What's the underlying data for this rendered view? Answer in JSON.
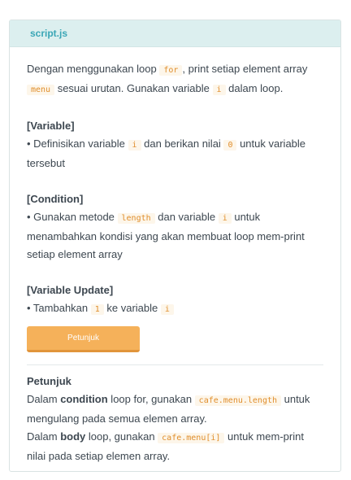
{
  "filename": "script.js",
  "intro": {
    "t1": "Dengan menggunakan loop ",
    "c1": "for",
    "t2": ", print setiap element array ",
    "c2": "menu",
    "t3": " sesuai urutan. Gunakan variable ",
    "c3": "i",
    "t4": " dalam loop."
  },
  "variable": {
    "title": "[Variable]",
    "t1": "• Definisikan variable ",
    "c1": "i",
    "t2": " dan berikan nilai ",
    "c2": "0",
    "t3": " untuk variable tersebut"
  },
  "condition": {
    "title": "[Condition]",
    "t1": "• Gunakan metode ",
    "c1": "length",
    "t2": " dan variable ",
    "c2": "i",
    "t3": " untuk menambahkan kondisi yang akan membuat loop mem-print setiap element array"
  },
  "update": {
    "title": "[Variable Update]",
    "t1": "• Tambahkan ",
    "c1": "1",
    "t2": " ke variable ",
    "c2": "i"
  },
  "hint_button": "Petunjuk",
  "hint": {
    "title": "Petunjuk",
    "p1_t1": "Dalam ",
    "p1_b": "condition",
    "p1_t2": " loop for, gunakan ",
    "p1_c": "cafe.menu.length",
    "p1_t3": " untuk mengulang pada semua elemen array.",
    "p2_t1": "Dalam ",
    "p2_b": "body",
    "p2_t2": " loop, gunakan ",
    "p2_c": "cafe.menu[i]",
    "p2_t3": " untuk mem-print nilai pada setiap elemen array."
  }
}
